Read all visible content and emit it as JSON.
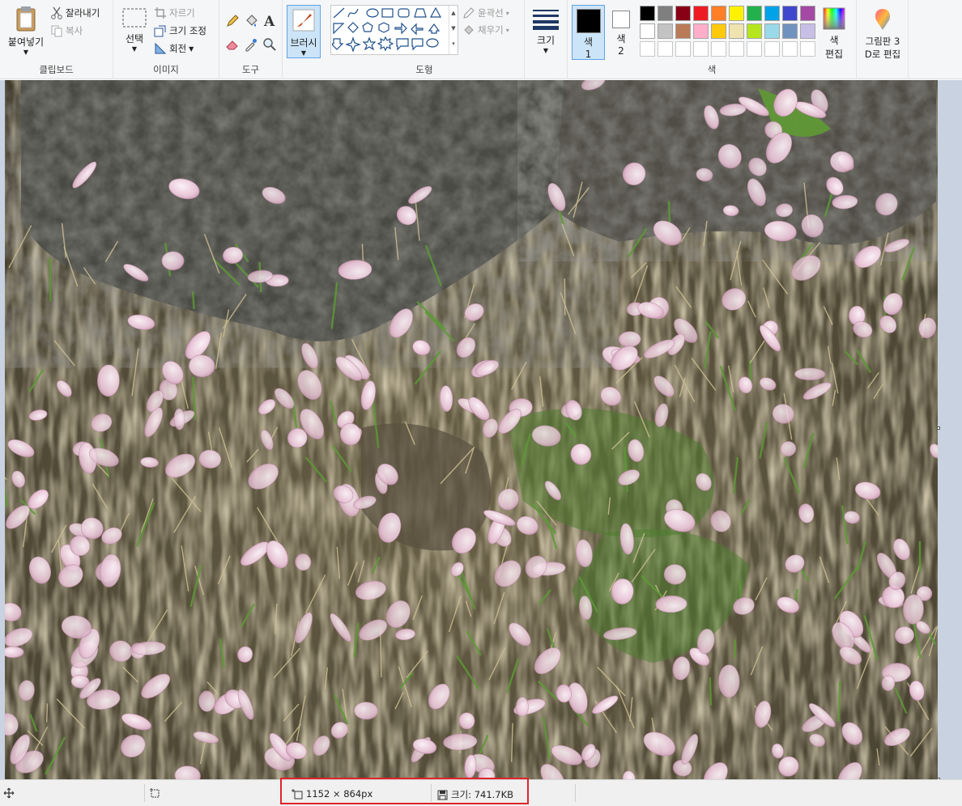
{
  "ribbon": {
    "clipboard": {
      "paste": "붙여넣기",
      "cut": "잘라내기",
      "copy": "복사",
      "label": "클립보드"
    },
    "image": {
      "select": "선택",
      "crop": "자르기",
      "resize": "크기 조정",
      "rotate": "회전",
      "label": "이미지"
    },
    "tools": {
      "label": "도구"
    },
    "brush": {
      "label": "브러시"
    },
    "shapes": {
      "outline": "윤곽선",
      "fill": "채우기",
      "label": "도형"
    },
    "size": {
      "label": "크기"
    },
    "colors": {
      "color1": "색",
      "color1_num": "1",
      "color2": "색",
      "color2_num": "2",
      "edit": "색",
      "edit2": "편집",
      "label": "색",
      "primary": "#000000",
      "secondary": "#ffffff",
      "palette_row1": [
        "#000000",
        "#7f7f7f",
        "#880015",
        "#ed1c24",
        "#ff7f27",
        "#fff200",
        "#22b14c",
        "#00a2e8",
        "#3f48cc",
        "#a349a4"
      ],
      "palette_row2": [
        "#ffffff",
        "#c3c3c3",
        "#b97a57",
        "#ffaec9",
        "#ffc90e",
        "#efe4b0",
        "#b5e61d",
        "#99d9ea",
        "#7092be",
        "#c8bfe7"
      ]
    },
    "paint3d": {
      "line1": "그림판 3",
      "line2": "D로 편집"
    }
  },
  "status": {
    "dimensions": "1152 × 864px",
    "filesize": "크기: 741.7KB"
  }
}
